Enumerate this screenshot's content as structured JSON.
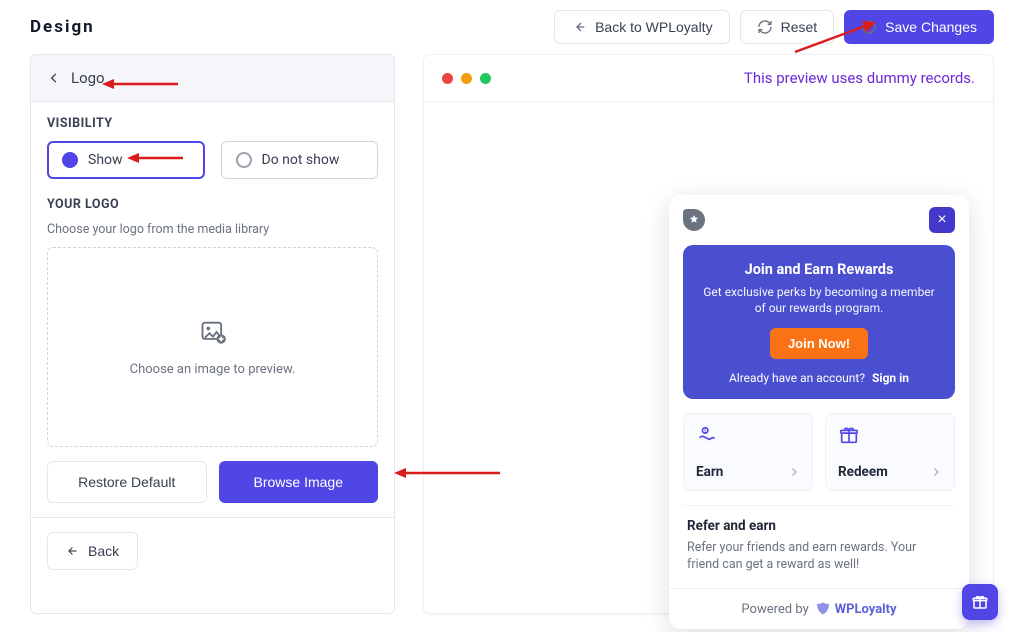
{
  "header": {
    "title": "Design",
    "back_label": "Back to WPLoyalty",
    "reset_label": "Reset",
    "save_label": "Save Changes"
  },
  "panel": {
    "header_title": "Logo",
    "visibility_label": "VISIBILITY",
    "show_label": "Show",
    "hide_label": "Do not show",
    "logo_section_label": "YOUR LOGO",
    "logo_hint": "Choose your logo from the media library",
    "dropzone_text": "Choose an image to preview.",
    "restore_label": "Restore Default",
    "browse_label": "Browse Image",
    "back_label": "Back"
  },
  "preview": {
    "note": "This preview uses dummy records.",
    "hero_title": "Join and Earn Rewards",
    "hero_sub": "Get exclusive perks by becoming a member of our rewards program.",
    "join_label": "Join Now!",
    "already_text": "Already have an account?",
    "signin_label": "Sign in",
    "earn_label": "Earn",
    "redeem_label": "Redeem",
    "refer_title": "Refer and earn",
    "refer_body": "Refer your friends and earn rewards. Your friend can get a reward as well!",
    "powered_prefix": "Powered by",
    "brand": "WPLoyalty"
  }
}
